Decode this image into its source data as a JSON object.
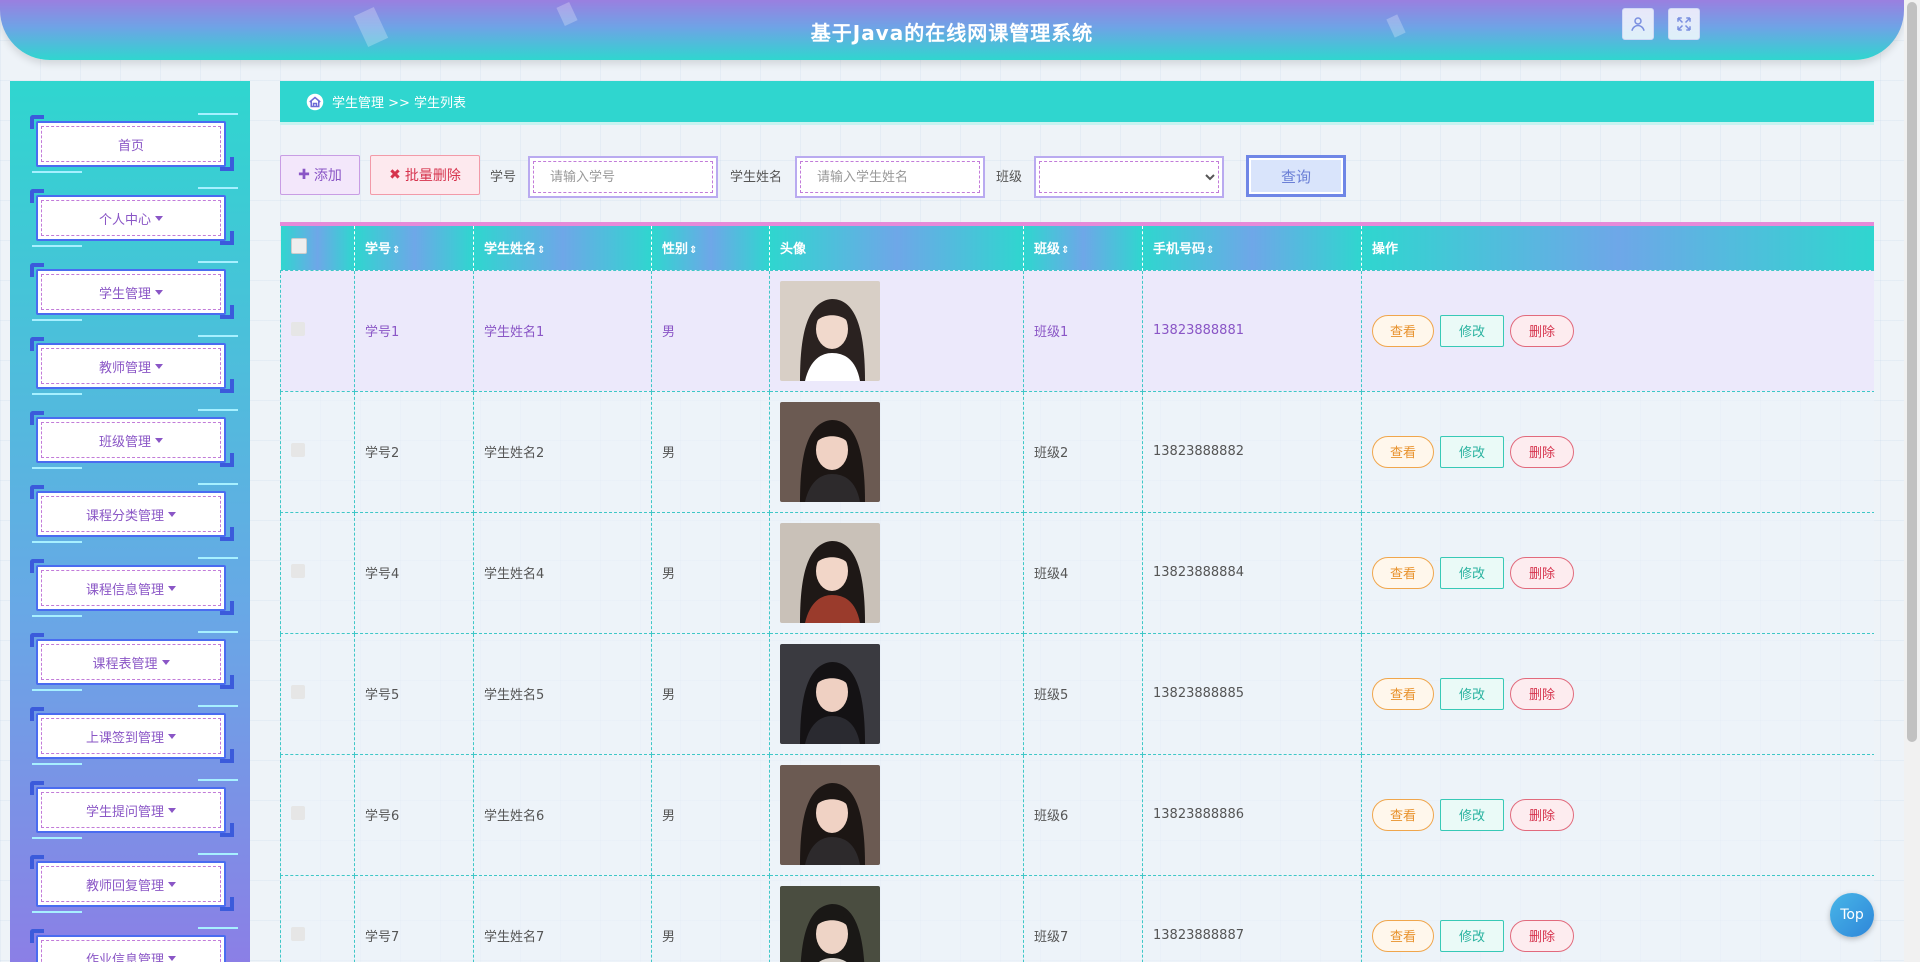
{
  "header": {
    "title": "基于Java的在线网课管理系统"
  },
  "sidebar": {
    "items": [
      {
        "label": "首页",
        "caret": false
      },
      {
        "label": "个人中心",
        "caret": true
      },
      {
        "label": "学生管理",
        "caret": true
      },
      {
        "label": "教师管理",
        "caret": true
      },
      {
        "label": "班级管理",
        "caret": true
      },
      {
        "label": "课程分类管理",
        "caret": true
      },
      {
        "label": "课程信息管理",
        "caret": true
      },
      {
        "label": "课程表管理",
        "caret": true
      },
      {
        "label": "上课签到管理",
        "caret": true
      },
      {
        "label": "学生提问管理",
        "caret": true
      },
      {
        "label": "教师回复管理",
        "caret": true
      },
      {
        "label": "作业信息管理",
        "caret": true
      }
    ]
  },
  "breadcrumb": {
    "text": "学生管理 >> 学生列表"
  },
  "toolbar": {
    "add_label": "添加",
    "batch_delete_label": "批量删除",
    "student_no_label": "学号",
    "student_no_placeholder": "请输入学号",
    "student_name_label": "学生姓名",
    "student_name_placeholder": "请输入学生姓名",
    "class_label": "班级",
    "class_value": "",
    "query_label": "查询"
  },
  "table": {
    "columns": [
      "学号",
      "学生姓名",
      "性别",
      "头像",
      "班级",
      "手机号码",
      "操作"
    ],
    "actions": {
      "view": "查看",
      "edit": "修改",
      "delete": "删除"
    },
    "rows": [
      {
        "no": "学号1",
        "name": "学生姓名1",
        "gender": "男",
        "class": "班级1",
        "phone": "13823888881"
      },
      {
        "no": "学号2",
        "name": "学生姓名2",
        "gender": "男",
        "class": "班级2",
        "phone": "13823888882"
      },
      {
        "no": "学号4",
        "name": "学生姓名4",
        "gender": "男",
        "class": "班级4",
        "phone": "13823888884"
      },
      {
        "no": "学号5",
        "name": "学生姓名5",
        "gender": "男",
        "class": "班级5",
        "phone": "13823888885"
      },
      {
        "no": "学号6",
        "name": "学生姓名6",
        "gender": "男",
        "class": "班级6",
        "phone": "13823888886"
      },
      {
        "no": "学号7",
        "name": "学生姓名7",
        "gender": "男",
        "class": "班级7",
        "phone": "13823888887"
      }
    ]
  },
  "top_button": {
    "label": "Top"
  },
  "colors": {
    "accent": "#2fd6cf",
    "purple": "#8a56c6",
    "header_top": "#9a7fe0"
  }
}
